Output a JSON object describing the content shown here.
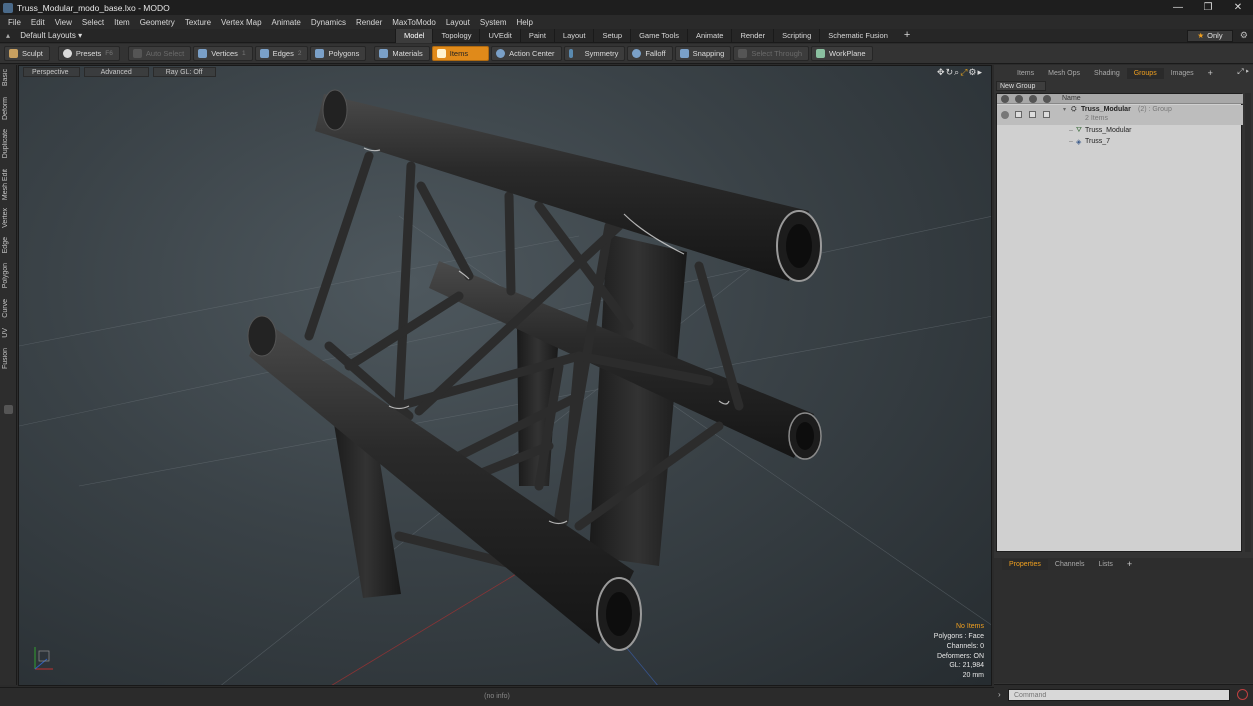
{
  "window": {
    "title": "Truss_Modular_modo_base.lxo - MODO",
    "controls": {
      "minimize": "—",
      "restore": "❐",
      "close": "✕"
    }
  },
  "menu": [
    "File",
    "Edit",
    "View",
    "Select",
    "Item",
    "Geometry",
    "Texture",
    "Vertex Map",
    "Animate",
    "Dynamics",
    "Render",
    "MaxToModo",
    "Layout",
    "System",
    "Help"
  ],
  "layouts": {
    "selector": "Default Layouts ▾",
    "tabs": [
      "Model",
      "Topology",
      "UVEdit",
      "Paint",
      "Layout",
      "Setup",
      "Game Tools",
      "Animate",
      "Render",
      "Scripting",
      "Schematic Fusion"
    ],
    "active_tab": "Model",
    "add": "+",
    "only_label": "Only"
  },
  "toolbar": {
    "sculpt": "Sculpt",
    "presets": "Presets",
    "presets_key": "F6",
    "auto_select": "Auto Select",
    "vertices": "Vertices",
    "vertices_count": "1",
    "edges": "Edges",
    "edges_count": "2",
    "polygons": "Polygons",
    "materials": "Materials",
    "items": "Items",
    "action_center": "Action Center",
    "symmetry": "Symmetry",
    "falloff": "Falloff",
    "snapping": "Snapping",
    "select_through": "Select Through",
    "workplane": "WorkPlane"
  },
  "left_tabs": [
    "Basic",
    "Deform",
    "Duplicate",
    "Mesh Edit",
    "Vertex",
    "Edge",
    "Polygon",
    "Curve",
    "UV",
    "Fusion"
  ],
  "viewport": {
    "perspective": "Perspective",
    "advanced": "Advanced",
    "ray": "Ray GL: Off",
    "info": {
      "no_items": "No Items",
      "polygons": "Polygons : Face",
      "channels": "Channels: 0",
      "deformers": "Deformers: ON",
      "gl": "GL: 21,984",
      "size": "20 mm"
    }
  },
  "status": "(no info)",
  "right_panel": {
    "tabs": [
      "Items",
      "Mesh Ops",
      "Shading",
      "Groups",
      "Images"
    ],
    "active_tab": "Groups",
    "new_group": "New Group",
    "name_header": "Name",
    "group_name": "Truss_Modular",
    "group_suffix": "(2) : Group",
    "group_count": "2 Items",
    "children": [
      "Truss_Modular",
      "Truss_7"
    ],
    "prop_tabs": [
      "Properties",
      "Channels",
      "Lists"
    ],
    "prop_active": "Properties",
    "command_placeholder": "Command"
  },
  "colors": {
    "accent": "#f0a020",
    "items_active": "#e08a1a"
  }
}
